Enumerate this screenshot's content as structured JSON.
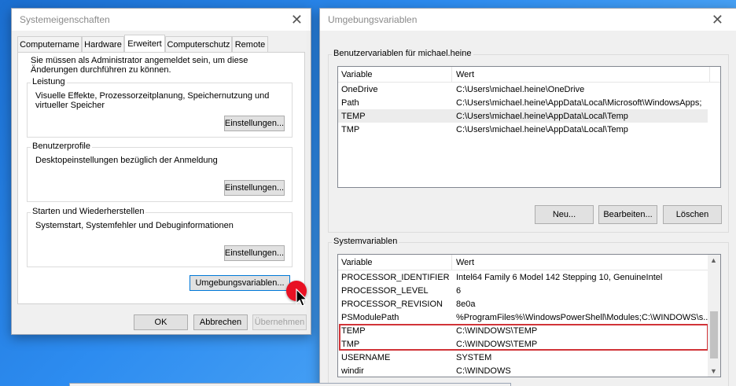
{
  "sys_props": {
    "title": "Systemeigenschaften",
    "tabs": [
      "Computername",
      "Hardware",
      "Erweitert",
      "Computerschutz",
      "Remote"
    ],
    "admin_note": "Sie müssen als Administrator angemeldet sein, um diese Änderungen durchführen zu können.",
    "performance": {
      "label": "Leistung",
      "text": "Visuelle Effekte, Prozessorzeitplanung, Speichernutzung und virtueller Speicher",
      "button": "Einstellungen..."
    },
    "profiles": {
      "label": "Benutzerprofile",
      "text": "Desktopeinstellungen bezüglich der Anmeldung",
      "button": "Einstellungen..."
    },
    "startup": {
      "label": "Starten und Wiederherstellen",
      "text": "Systemstart, Systemfehler und Debuginformationen",
      "button": "Einstellungen..."
    },
    "env_button": "Umgebungsvariablen...",
    "ok": "OK",
    "cancel": "Abbrechen",
    "apply": "Übernehmen"
  },
  "env_vars": {
    "title": "Umgebungsvariablen",
    "user_group_label": "Benutzervariablen für michael.heine",
    "user_headers": {
      "variable": "Variable",
      "value": "Wert"
    },
    "user_rows": [
      {
        "name": "OneDrive",
        "value": "C:\\Users\\michael.heine\\OneDrive"
      },
      {
        "name": "Path",
        "value": "C:\\Users\\michael.heine\\AppData\\Local\\Microsoft\\WindowsApps;"
      },
      {
        "name": "TEMP",
        "value": "C:\\Users\\michael.heine\\AppData\\Local\\Temp"
      },
      {
        "name": "TMP",
        "value": "C:\\Users\\michael.heine\\AppData\\Local\\Temp"
      }
    ],
    "user_buttons": {
      "new": "Neu...",
      "edit": "Bearbeiten...",
      "delete": "Löschen"
    },
    "sys_group_label": "Systemvariablen",
    "sys_headers": {
      "variable": "Variable",
      "value": "Wert"
    },
    "sys_rows": [
      {
        "name": "PROCESSOR_IDENTIFIER",
        "value": "Intel64 Family 6 Model 142 Stepping 10, GenuineIntel"
      },
      {
        "name": "PROCESSOR_LEVEL",
        "value": "6"
      },
      {
        "name": "PROCESSOR_REVISION",
        "value": "8e0a"
      },
      {
        "name": "PSModulePath",
        "value": "%ProgramFiles%\\WindowsPowerShell\\Modules;C:\\WINDOWS\\s..."
      },
      {
        "name": "TEMP",
        "value": "C:\\WINDOWS\\TEMP"
      },
      {
        "name": "TMP",
        "value": "C:\\WINDOWS\\TEMP"
      },
      {
        "name": "USERNAME",
        "value": "SYSTEM"
      },
      {
        "name": "windir",
        "value": "C:\\WINDOWS"
      }
    ]
  },
  "colors": {
    "highlight_box": "#d13438",
    "cursor_dot": "#e81123"
  }
}
